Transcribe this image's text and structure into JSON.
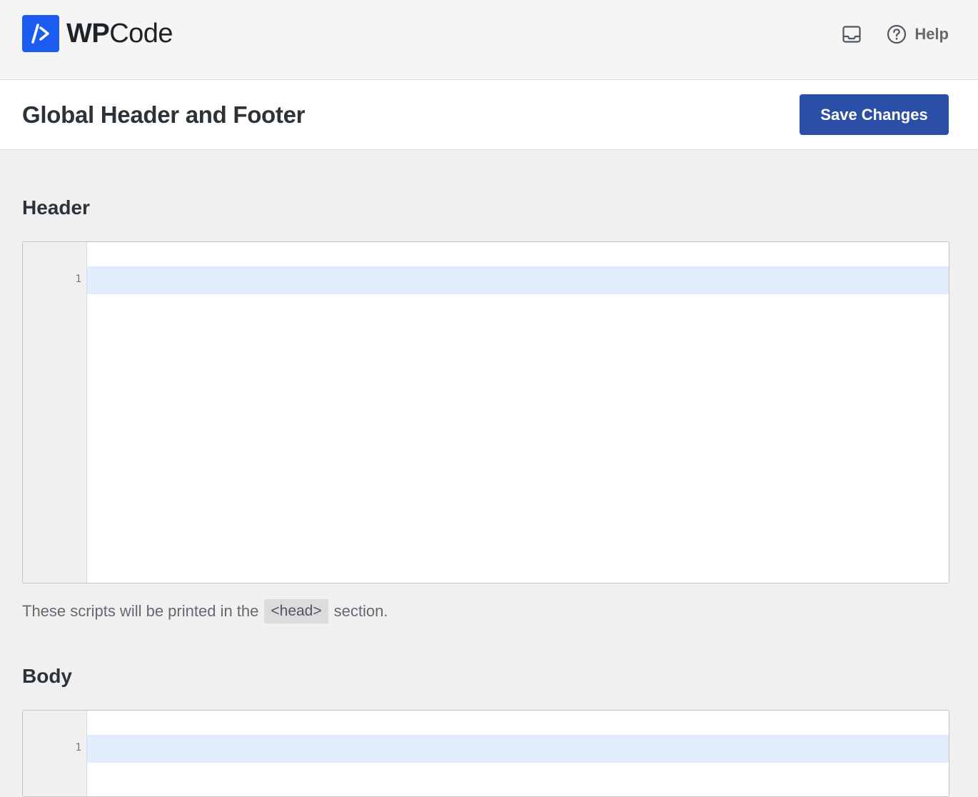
{
  "app": {
    "logo_text_bold": "WP",
    "logo_text_regular": "Code",
    "help_label": "Help"
  },
  "page": {
    "title": "Global Header and Footer",
    "save_label": "Save Changes"
  },
  "header_section": {
    "heading": "Header",
    "line_number": "1",
    "code": "",
    "help_text_before": "These scripts will be printed in the",
    "help_code": "<head>",
    "help_text_after": "section."
  },
  "body_section": {
    "heading": "Body",
    "line_number": "1",
    "code": ""
  },
  "colors": {
    "brand": "#1b5cf0",
    "primary_button": "#2b4ea6",
    "active_line": "#e1ecfc"
  },
  "icons": {
    "inbox": "inbox-icon",
    "help": "help-circle-icon",
    "logo": "code-slash-icon"
  }
}
